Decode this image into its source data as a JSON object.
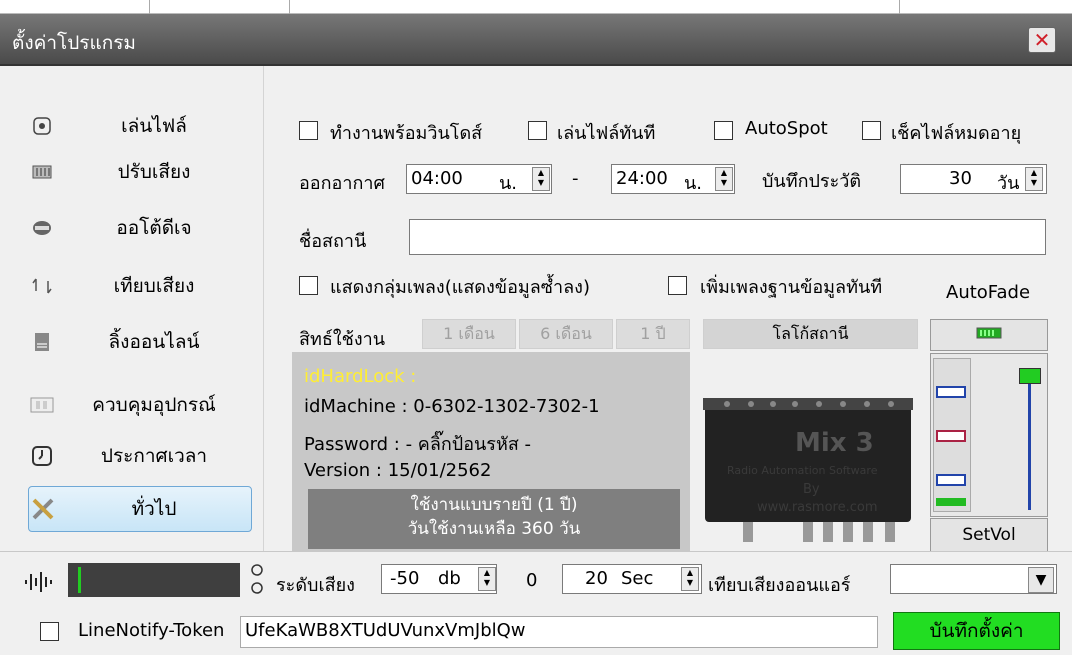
{
  "window": {
    "title": "ตั้งค่าโปรแกรม"
  },
  "sidebar": {
    "items": [
      {
        "label": "เล่นไฟล์",
        "icon": "speaker-icon"
      },
      {
        "label": "ปรับเสียง",
        "icon": "equalizer-icon"
      },
      {
        "label": "ออโต้ดีเจ",
        "icon": "dj-icon"
      },
      {
        "label": "เทียบเสียง",
        "icon": "sync-icon"
      },
      {
        "label": "ลิ้งออนไลน์",
        "icon": "online-link-icon"
      },
      {
        "label": "ควบคุมอุปกรณ์",
        "icon": "device-icon"
      },
      {
        "label": "ประกาศเวลา",
        "icon": "clock-icon"
      },
      {
        "label": "ทั่วไป",
        "icon": "tools-icon"
      }
    ],
    "selected": "ทั่วไป"
  },
  "options": {
    "run_with_windows": "ทำงานพร้อมวินโดส์",
    "play_instantly": "เล่นไฟล์ทันที",
    "autospot": "AutoSpot",
    "check_expired": "เช็คไฟล์หมดอายุ"
  },
  "schedule": {
    "onair_label": "ออกอากาศ",
    "start_time": "04:00",
    "unit": "น.",
    "dash": "-",
    "end_time": "24:00",
    "log_label": "บันทึกประวัติ",
    "log_days": "30",
    "days_unit": "วัน"
  },
  "station": {
    "name_label": "ชื่อสถานี",
    "name_value": ""
  },
  "options2": {
    "show_song_group": "แสดงกลุ่มเพลง(แสดงข้อมูลซ้ำลง)",
    "add_songs_db": "เพิ่มเพลงฐานข้อมูลทันที",
    "autofade": "AutoFade"
  },
  "license": {
    "label": "สิทธ์ใช้งาน",
    "tabs": [
      "1 เดือน",
      "6 เดือน",
      "1 ปี"
    ],
    "logo_label": "โลโก้สถานี",
    "hardlock": "idHardLock :",
    "machine": "idMachine : 0-6302-1302-7302-1",
    "password": "Password : - คลิ๊กป้อนรหัส -",
    "version": "Version : 15/01/2562",
    "usage_line1": "ใช้งานแบบรายปี (1 ปี)",
    "usage_line2": "วันใช้งานเหลือ 360 วัน"
  },
  "logo": {
    "brand": "Mix 3",
    "subtitle": "Radio Automation Software",
    "by": "By",
    "url": "www.rasmore.com"
  },
  "volume": {
    "setvol_label": "SetVol",
    "level_fraction": 0.85
  },
  "bottom": {
    "level_label": "ระดับเสียง",
    "level_value": "-50",
    "db_unit": "db",
    "zero": "0",
    "sec_value": "20",
    "sec_unit": "Sec",
    "compare_label": "เทียบเสียงออนแอร์",
    "compare_value": "",
    "line_notify_label": "LineNotify-Token",
    "token": "UfeKaWB8XTUdUVunxVmJblQw",
    "save_label": "บันทึกตั้งค่า"
  },
  "colors": {
    "save_bg": "#22dd22",
    "hardlock": "#ffee33",
    "meter": "#22cc22"
  }
}
